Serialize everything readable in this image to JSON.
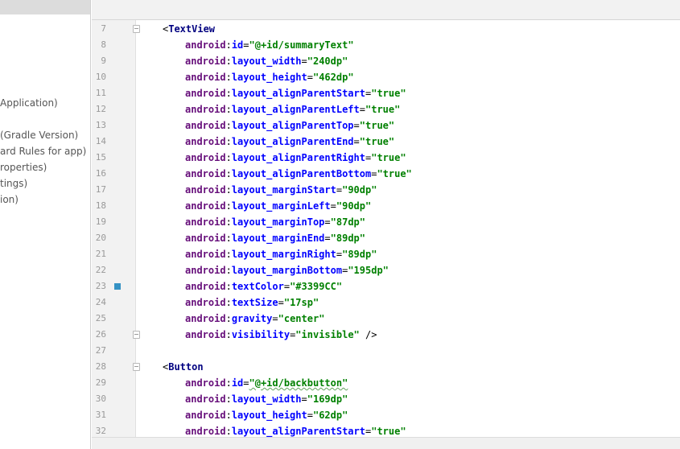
{
  "project_panel": {
    "items": [
      {
        "text": "Application)",
        "row": 0
      },
      {
        "text": "(Gradle Version)",
        "row": 2
      },
      {
        "text": "ard Rules for app)",
        "row": 3
      },
      {
        "text": "roperties)",
        "row": 4
      },
      {
        "text": "tings)",
        "row": 5
      },
      {
        "text": "ion)",
        "row": 6
      }
    ]
  },
  "editor": {
    "lines": [
      {
        "n": "7",
        "fold": true,
        "marker": false,
        "tokens": [
          {
            "t": "punct",
            "v": "<"
          },
          {
            "t": "tag",
            "v": "TextView"
          }
        ],
        "indent": 1
      },
      {
        "n": "8",
        "fold": false,
        "marker": false,
        "tokens": [
          {
            "t": "ns",
            "v": "android"
          },
          {
            "t": "punct",
            "v": ":"
          },
          {
            "t": "attr",
            "v": "id"
          },
          {
            "t": "eq",
            "v": "="
          },
          {
            "t": "val",
            "v": "\"@+id/summaryText\""
          }
        ],
        "indent": 2
      },
      {
        "n": "9",
        "fold": false,
        "marker": false,
        "tokens": [
          {
            "t": "ns",
            "v": "android"
          },
          {
            "t": "punct",
            "v": ":"
          },
          {
            "t": "attr",
            "v": "layout_width"
          },
          {
            "t": "eq",
            "v": "="
          },
          {
            "t": "val",
            "v": "\"240dp\""
          }
        ],
        "indent": 2
      },
      {
        "n": "10",
        "fold": false,
        "marker": false,
        "tokens": [
          {
            "t": "ns",
            "v": "android"
          },
          {
            "t": "punct",
            "v": ":"
          },
          {
            "t": "attr",
            "v": "layout_height"
          },
          {
            "t": "eq",
            "v": "="
          },
          {
            "t": "val",
            "v": "\"462dp\""
          }
        ],
        "indent": 2
      },
      {
        "n": "11",
        "fold": false,
        "marker": false,
        "tokens": [
          {
            "t": "ns",
            "v": "android"
          },
          {
            "t": "punct",
            "v": ":"
          },
          {
            "t": "attr",
            "v": "layout_alignParentStart"
          },
          {
            "t": "eq",
            "v": "="
          },
          {
            "t": "val",
            "v": "\"true\""
          }
        ],
        "indent": 2
      },
      {
        "n": "12",
        "fold": false,
        "marker": false,
        "tokens": [
          {
            "t": "ns",
            "v": "android"
          },
          {
            "t": "punct",
            "v": ":"
          },
          {
            "t": "attr",
            "v": "layout_alignParentLeft"
          },
          {
            "t": "eq",
            "v": "="
          },
          {
            "t": "val",
            "v": "\"true\""
          }
        ],
        "indent": 2
      },
      {
        "n": "13",
        "fold": false,
        "marker": false,
        "tokens": [
          {
            "t": "ns",
            "v": "android"
          },
          {
            "t": "punct",
            "v": ":"
          },
          {
            "t": "attr",
            "v": "layout_alignParentTop"
          },
          {
            "t": "eq",
            "v": "="
          },
          {
            "t": "val",
            "v": "\"true\""
          }
        ],
        "indent": 2
      },
      {
        "n": "14",
        "fold": false,
        "marker": false,
        "tokens": [
          {
            "t": "ns",
            "v": "android"
          },
          {
            "t": "punct",
            "v": ":"
          },
          {
            "t": "attr",
            "v": "layout_alignParentEnd"
          },
          {
            "t": "eq",
            "v": "="
          },
          {
            "t": "val",
            "v": "\"true\""
          }
        ],
        "indent": 2
      },
      {
        "n": "15",
        "fold": false,
        "marker": false,
        "tokens": [
          {
            "t": "ns",
            "v": "android"
          },
          {
            "t": "punct",
            "v": ":"
          },
          {
            "t": "attr",
            "v": "layout_alignParentRight"
          },
          {
            "t": "eq",
            "v": "="
          },
          {
            "t": "val",
            "v": "\"true\""
          }
        ],
        "indent": 2
      },
      {
        "n": "16",
        "fold": false,
        "marker": false,
        "tokens": [
          {
            "t": "ns",
            "v": "android"
          },
          {
            "t": "punct",
            "v": ":"
          },
          {
            "t": "attr",
            "v": "layout_alignParentBottom"
          },
          {
            "t": "eq",
            "v": "="
          },
          {
            "t": "val",
            "v": "\"true\""
          }
        ],
        "indent": 2
      },
      {
        "n": "17",
        "fold": false,
        "marker": false,
        "tokens": [
          {
            "t": "ns",
            "v": "android"
          },
          {
            "t": "punct",
            "v": ":"
          },
          {
            "t": "attr",
            "v": "layout_marginStart"
          },
          {
            "t": "eq",
            "v": "="
          },
          {
            "t": "val",
            "v": "\"90dp\""
          }
        ],
        "indent": 2
      },
      {
        "n": "18",
        "fold": false,
        "marker": false,
        "tokens": [
          {
            "t": "ns",
            "v": "android"
          },
          {
            "t": "punct",
            "v": ":"
          },
          {
            "t": "attr",
            "v": "layout_marginLeft"
          },
          {
            "t": "eq",
            "v": "="
          },
          {
            "t": "val",
            "v": "\"90dp\""
          }
        ],
        "indent": 2
      },
      {
        "n": "19",
        "fold": false,
        "marker": false,
        "tokens": [
          {
            "t": "ns",
            "v": "android"
          },
          {
            "t": "punct",
            "v": ":"
          },
          {
            "t": "attr",
            "v": "layout_marginTop"
          },
          {
            "t": "eq",
            "v": "="
          },
          {
            "t": "val",
            "v": "\"87dp\""
          }
        ],
        "indent": 2
      },
      {
        "n": "20",
        "fold": false,
        "marker": false,
        "tokens": [
          {
            "t": "ns",
            "v": "android"
          },
          {
            "t": "punct",
            "v": ":"
          },
          {
            "t": "attr",
            "v": "layout_marginEnd"
          },
          {
            "t": "eq",
            "v": "="
          },
          {
            "t": "val",
            "v": "\"89dp\""
          }
        ],
        "indent": 2
      },
      {
        "n": "21",
        "fold": false,
        "marker": false,
        "tokens": [
          {
            "t": "ns",
            "v": "android"
          },
          {
            "t": "punct",
            "v": ":"
          },
          {
            "t": "attr",
            "v": "layout_marginRight"
          },
          {
            "t": "eq",
            "v": "="
          },
          {
            "t": "val",
            "v": "\"89dp\""
          }
        ],
        "indent": 2
      },
      {
        "n": "22",
        "fold": false,
        "marker": false,
        "tokens": [
          {
            "t": "ns",
            "v": "android"
          },
          {
            "t": "punct",
            "v": ":"
          },
          {
            "t": "attr",
            "v": "layout_marginBottom"
          },
          {
            "t": "eq",
            "v": "="
          },
          {
            "t": "val",
            "v": "\"195dp\""
          }
        ],
        "indent": 2
      },
      {
        "n": "23",
        "fold": false,
        "marker": true,
        "tokens": [
          {
            "t": "ns",
            "v": "android"
          },
          {
            "t": "punct",
            "v": ":"
          },
          {
            "t": "attr",
            "v": "textColor"
          },
          {
            "t": "eq",
            "v": "="
          },
          {
            "t": "val",
            "v": "\"#3399CC\""
          }
        ],
        "indent": 2
      },
      {
        "n": "24",
        "fold": false,
        "marker": false,
        "tokens": [
          {
            "t": "ns",
            "v": "android"
          },
          {
            "t": "punct",
            "v": ":"
          },
          {
            "t": "attr",
            "v": "textSize"
          },
          {
            "t": "eq",
            "v": "="
          },
          {
            "t": "val",
            "v": "\"17sp\""
          }
        ],
        "indent": 2
      },
      {
        "n": "25",
        "fold": false,
        "marker": false,
        "tokens": [
          {
            "t": "ns",
            "v": "android"
          },
          {
            "t": "punct",
            "v": ":"
          },
          {
            "t": "attr",
            "v": "gravity"
          },
          {
            "t": "eq",
            "v": "="
          },
          {
            "t": "val",
            "v": "\"center\""
          }
        ],
        "indent": 2
      },
      {
        "n": "26",
        "fold": true,
        "marker": false,
        "tokens": [
          {
            "t": "ns",
            "v": "android"
          },
          {
            "t": "punct",
            "v": ":"
          },
          {
            "t": "attr",
            "v": "visibility"
          },
          {
            "t": "eq",
            "v": "="
          },
          {
            "t": "val",
            "v": "\"invisible\""
          },
          {
            "t": "punct",
            "v": " />"
          }
        ],
        "indent": 2
      },
      {
        "n": "27",
        "fold": false,
        "marker": false,
        "tokens": [],
        "indent": 0
      },
      {
        "n": "28",
        "fold": true,
        "marker": false,
        "tokens": [
          {
            "t": "punct",
            "v": "<"
          },
          {
            "t": "tag",
            "v": "Button"
          }
        ],
        "indent": 1
      },
      {
        "n": "29",
        "fold": false,
        "marker": false,
        "tokens": [
          {
            "t": "ns",
            "v": "android"
          },
          {
            "t": "punct",
            "v": ":"
          },
          {
            "t": "attr",
            "v": "id"
          },
          {
            "t": "eq",
            "v": "="
          },
          {
            "t": "val",
            "v": "\"@+id/backbutton\"",
            "ul": true
          }
        ],
        "indent": 2
      },
      {
        "n": "30",
        "fold": false,
        "marker": false,
        "tokens": [
          {
            "t": "ns",
            "v": "android"
          },
          {
            "t": "punct",
            "v": ":"
          },
          {
            "t": "attr",
            "v": "layout_width"
          },
          {
            "t": "eq",
            "v": "="
          },
          {
            "t": "val",
            "v": "\"169dp\""
          }
        ],
        "indent": 2
      },
      {
        "n": "31",
        "fold": false,
        "marker": false,
        "tokens": [
          {
            "t": "ns",
            "v": "android"
          },
          {
            "t": "punct",
            "v": ":"
          },
          {
            "t": "attr",
            "v": "layout_height"
          },
          {
            "t": "eq",
            "v": "="
          },
          {
            "t": "val",
            "v": "\"62dp\""
          }
        ],
        "indent": 2
      },
      {
        "n": "32",
        "fold": false,
        "marker": false,
        "tokens": [
          {
            "t": "ns",
            "v": "android"
          },
          {
            "t": "punct",
            "v": ":"
          },
          {
            "t": "attr",
            "v": "layout_alignParentStart"
          },
          {
            "t": "eq",
            "v": "="
          },
          {
            "t": "val",
            "v": "\"true\""
          }
        ],
        "indent": 2
      }
    ]
  }
}
